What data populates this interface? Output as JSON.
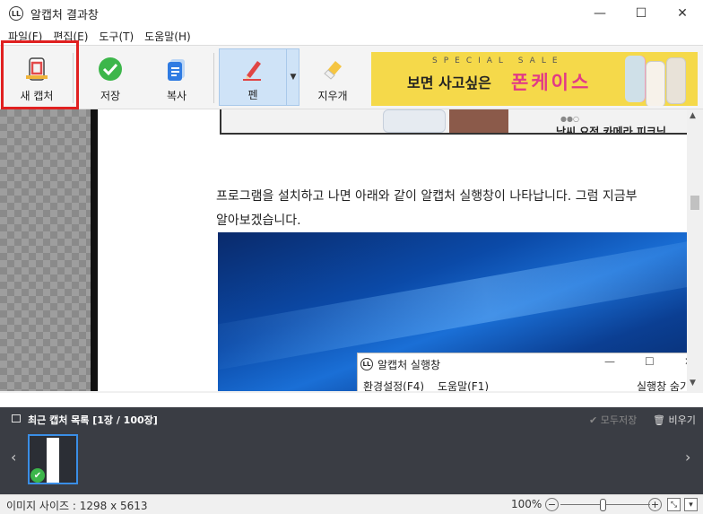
{
  "window": {
    "app_icon_text": "LL",
    "title": "알캡처 결과창",
    "minimize_glyph": "—",
    "maximize_glyph": "☐",
    "close_glyph": "✕"
  },
  "menu": [
    "파일(F)",
    "편집(E)",
    "도구(T)",
    "도움말(H)"
  ],
  "toolbar": {
    "new_capture": "새 캡처",
    "save": "저장",
    "copy": "복사",
    "pen": "펜",
    "eraser": "지우개",
    "dropdown_glyph": "▼"
  },
  "banner": {
    "special": "SPECIAL SALE",
    "headline": "보면 사고싶은",
    "brand": "폰케이스"
  },
  "content": {
    "top_caption": "낮씨 요정 카메라 피크닉",
    "dots": "●●○",
    "paragraph_line1": "프로그램을 설치하고 나면 아래와 같이 알캡처 실행창이 나타납니다. 그럼 지금부",
    "paragraph_line2": "알아보겠습니다.",
    "subwindow": {
      "icon_text": "LL",
      "title": "알캡처 실행창",
      "menu1": "환경설정(F4)",
      "menu2": "도움말(F1)",
      "right_text": "실행창 숨기",
      "min_glyph": "—",
      "max_glyph": "☐",
      "close_glyph": "✕"
    }
  },
  "scroll": {
    "up": "▲",
    "down": "▼",
    "left": "◀",
    "right": "▶"
  },
  "recent": {
    "header": "최근 캡처 목록 [1장 / 100장]",
    "save_all": "✔ 모두저장",
    "clear": "🗑 비우기",
    "prev": "‹",
    "next": "›",
    "check_glyph": "✔"
  },
  "status": {
    "image_size": "이미지 사이즈 : 1298 x 5613",
    "zoom": "100%",
    "zoom_out": "−",
    "zoom_in": "+",
    "fit_glyph": "⤡",
    "menu_glyph": "▾"
  },
  "colors": {
    "highlight": "#e02020",
    "banner_bg": "#f5d94a",
    "brand_text": "#e23a86",
    "panel_bg": "#3a3d44"
  }
}
